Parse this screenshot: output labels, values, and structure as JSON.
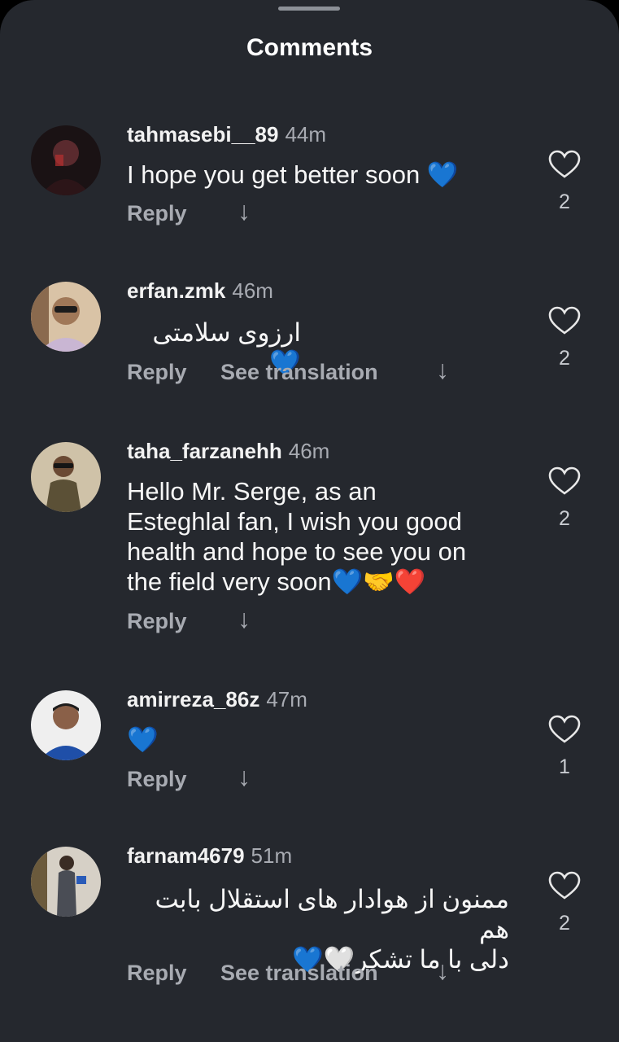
{
  "header": {
    "title": "Comments"
  },
  "labels": {
    "reply": "Reply",
    "see_translation": "See translation",
    "arrow": "↓"
  },
  "comments": [
    {
      "username": "tahmasebi__89",
      "time": "44m",
      "text": "I hope you get better soon 💙",
      "likes": "2",
      "avatar_color": "#3a1f24"
    },
    {
      "username": "erfan.zmk",
      "time": "46m",
      "text": "ارزوی سلامتی 💙",
      "likes": "2",
      "avatar_color": "#c6a98a"
    },
    {
      "username": "taha_farzanehh",
      "time": "46m",
      "text": "Hello Mr. Serge, as an\nEsteghlal fan, I wish you good\nhealth and hope to see you on\nthe field very soon💙🤝❤️",
      "likes": "2",
      "avatar_color": "#b8a88e"
    },
    {
      "username": "amirreza_86z",
      "time": "47m",
      "text": "💙",
      "likes": "1",
      "avatar_color": "#e8e8e8"
    },
    {
      "username": "farnam4679",
      "time": "51m",
      "text": "ممنون از هوادار های استقلال بابت هم\nدلی با ما تشکر🤍💙",
      "likes": "2",
      "avatar_color": "#c8c3bb"
    }
  ]
}
